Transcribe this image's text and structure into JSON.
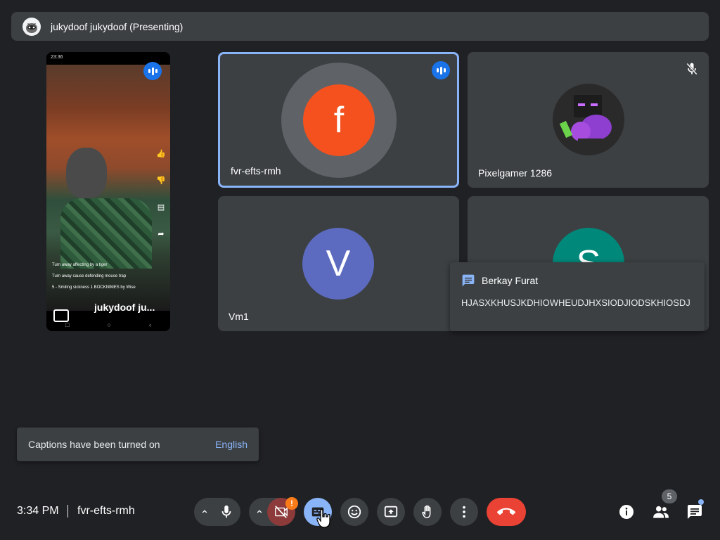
{
  "presenter_bar": {
    "name": "jukydoof jukydoof (Presenting)"
  },
  "screen_share": {
    "status_time": "23:36",
    "caption_line_1": "Turn away affecting by a tiger",
    "caption_line_2": "Turn away cause defending mouse trap",
    "caption_line_3": "5 - Smiling sickness 1 BOCKNIMES by Wise",
    "presenter_label": "jukydoof ju..."
  },
  "tiles": [
    {
      "name": "fvr-efts-rmh",
      "initial": "f",
      "color": "#f4511e",
      "speaking": true
    },
    {
      "name": "Pixelgamer 1286",
      "muted": true
    },
    {
      "name": "Vm1",
      "initial": "V",
      "color": "#5c6bc0"
    },
    {
      "name": "",
      "initial": "S",
      "color": "#00897b"
    }
  ],
  "chat_popup": {
    "sender": "Berkay Furat",
    "message": "HJASXKHUSJKDHIOWHEUDJHXSIODJIODSKHIOSDJ"
  },
  "toast": {
    "text": "Captions have been turned on",
    "action": "English"
  },
  "bottom_bar": {
    "time": "3:34 PM",
    "meeting_code": "fvr-efts-rmh",
    "camera_warning": "!",
    "participants_count": "5"
  },
  "colors": {
    "background": "#202124",
    "tile": "#3c4043",
    "accent": "#8ab4f8",
    "end_call": "#ea4335",
    "warning": "#fa7b17"
  }
}
